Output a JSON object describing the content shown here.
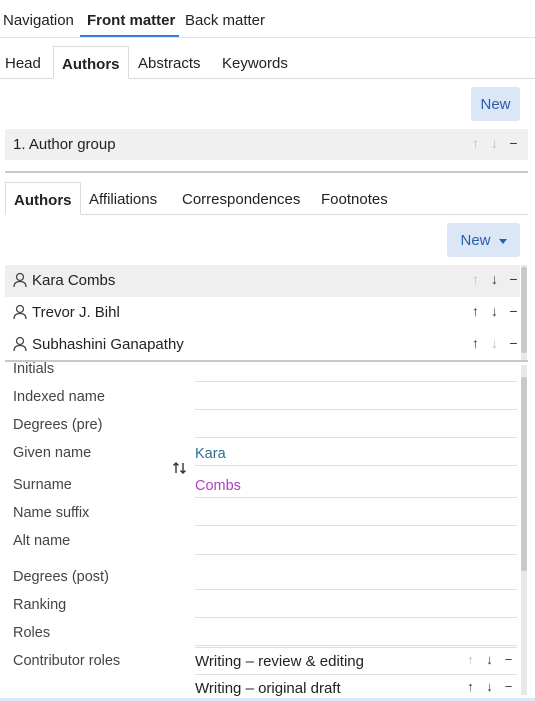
{
  "top_tabs": [
    "Navigation",
    "Front matter",
    "Back matter"
  ],
  "section_tabs": [
    "Head",
    "Authors",
    "Abstracts",
    "Keywords"
  ],
  "new_button_label": "New",
  "author_group_label": "1. Author group",
  "author_tabs": [
    "Authors",
    "Affiliations",
    "Correspondences",
    "Footnotes"
  ],
  "new_dropdown_label": "New",
  "authors": [
    "Kara Combs",
    "Trevor J. Bihl",
    "Subhashini Ganapathy"
  ],
  "form_labels": {
    "initials": "Initials",
    "indexed_name": "Indexed name",
    "degrees_pre": "Degrees (pre)",
    "given_name": "Given name",
    "surname": "Surname",
    "name_suffix": "Name suffix",
    "alt_name": "Alt name",
    "degrees_post": "Degrees (post)",
    "ranking": "Ranking",
    "roles": "Roles",
    "contributor_roles": "Contributor roles"
  },
  "form_values": {
    "given_name": "Kara",
    "surname": "Combs"
  },
  "contributor_roles": [
    "Writing – review & editing",
    "Writing – original draft"
  ],
  "colors": {
    "accent": "#3b7ee0",
    "button_bg": "#dbe6f7",
    "button_text": "#2a5db0",
    "given_name_text": "#2a6f8f",
    "surname_text": "#b140c4"
  },
  "icons": {
    "up": "arrow-up-icon",
    "down": "arrow-down-icon",
    "remove": "minus-icon",
    "person": "person-icon",
    "swap": "swap-vertical-icon"
  }
}
